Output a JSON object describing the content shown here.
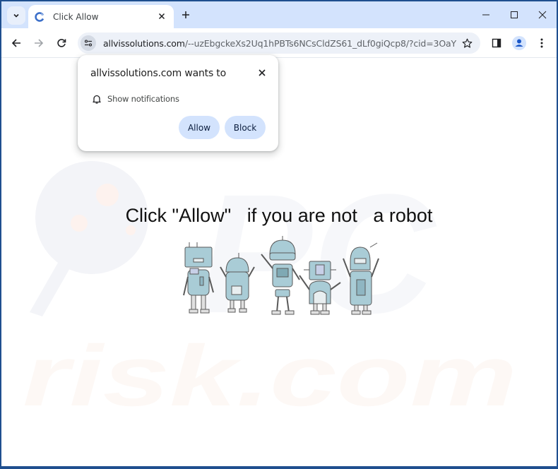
{
  "browser": {
    "tab": {
      "title": "Click Allow",
      "favicon": "loading-spinner-icon"
    },
    "new_tab_label": "+",
    "window_controls": [
      "minimize-icon",
      "maximize-icon",
      "close-icon"
    ],
    "address_bar": {
      "domain": "allvissolutions.com",
      "path": "/--uzEbgckeXs2Uq1hPBTs6NCsCldZS61_dLf0giQcp8/?cid=3OaY8iv83Cz..."
    },
    "toolbar_icons": [
      "back-icon",
      "forward-icon",
      "reload-icon",
      "site-info-icon",
      "bookmark-star-icon",
      "side-panel-icon",
      "profile-icon",
      "menu-icon"
    ]
  },
  "permission_popup": {
    "title": "allvissolutions.com wants to",
    "permission": "Show notifications",
    "allow_label": "Allow",
    "block_label": "Block"
  },
  "page": {
    "headline": "Click \"Allow\"   if you are not   a robot",
    "illustration": "five cartoon robots",
    "watermark_top": "PC",
    "watermark_bottom": "risk.com"
  },
  "colors": {
    "titlebar": "#d3e3fd",
    "button_bg": "#d3e3fd",
    "window_border": "#1f4f8f",
    "robot_body": "#a9ccd6"
  }
}
